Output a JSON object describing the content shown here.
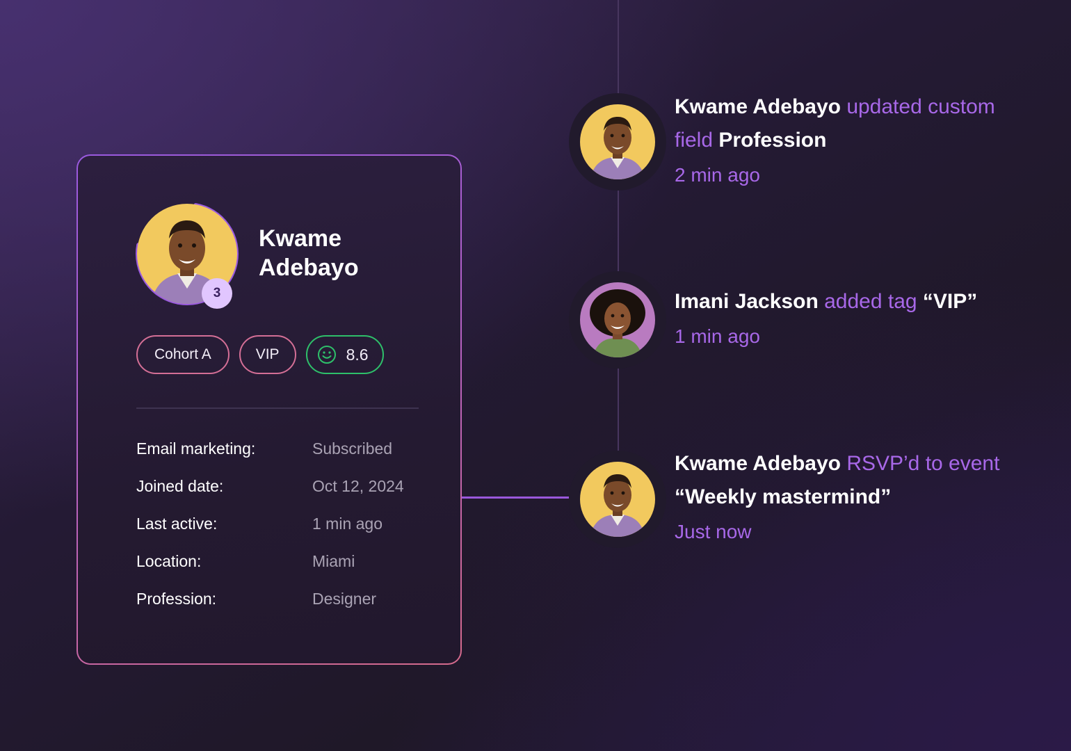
{
  "profile": {
    "name": "Kwame Adebayo",
    "badge_count": "3",
    "tags": [
      "Cohort A",
      "VIP"
    ],
    "score": "8.6",
    "details": [
      {
        "label": "Email marketing:",
        "value": "Subscribed"
      },
      {
        "label": "Joined date:",
        "value": "Oct 12, 2024"
      },
      {
        "label": "Last active:",
        "value": "1 min ago"
      },
      {
        "label": "Location:",
        "value": "Miami"
      },
      {
        "label": "Profession:",
        "value": "Designer"
      }
    ]
  },
  "activity": [
    {
      "actor": "Kwame Adebayo",
      "action": "updated custom field",
      "object": "Profession",
      "time": "2 min ago"
    },
    {
      "actor": "Imani Jackson",
      "action": "added tag",
      "object": "“VIP”",
      "time": "1 min ago"
    },
    {
      "actor": "Kwame Adebayo",
      "action": "RSVP’d to event",
      "object": "“Weekly mastermind”",
      "time": "Just now"
    }
  ],
  "colors": {
    "accent_purple": "#a868e8",
    "tag_border": "#d46f96",
    "score_green": "#2ec06a",
    "badge_bg": "#e1c6ff"
  },
  "icons": {
    "score_icon": "smiley-face-icon"
  }
}
